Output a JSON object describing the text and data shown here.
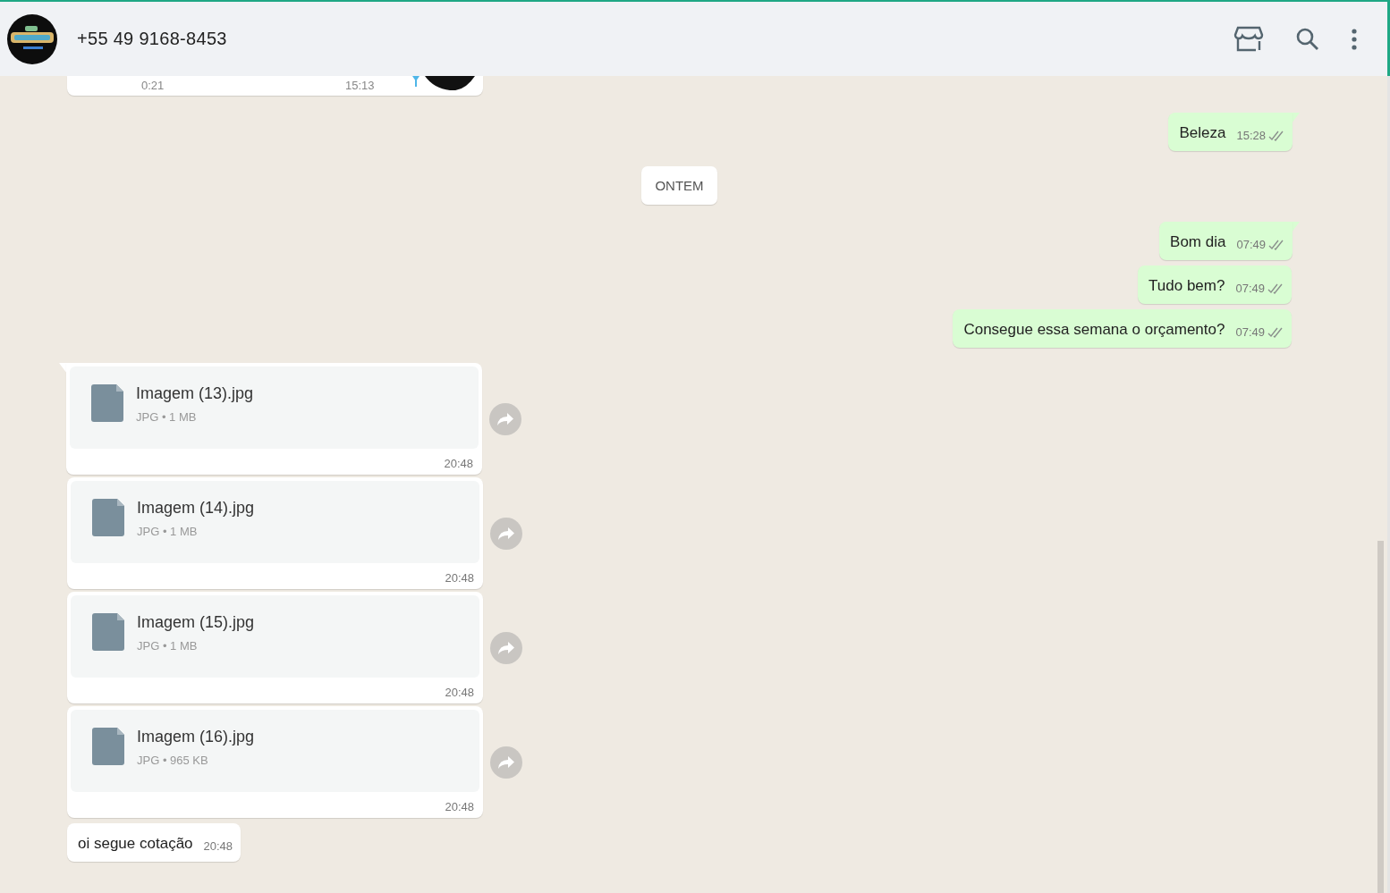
{
  "header": {
    "title": "+55 49 9168-8453"
  },
  "messages": [
    {
      "kind": "audio",
      "duration": "0:21",
      "time": "15:13"
    },
    {
      "kind": "text",
      "outgoing": true,
      "text": "Beleza",
      "time": "15:28",
      "read": false,
      "tail": true
    },
    {
      "kind": "date",
      "text": "ONTEM"
    },
    {
      "kind": "text",
      "outgoing": true,
      "text": "Bom dia",
      "time": "07:49",
      "read": false,
      "tail": true
    },
    {
      "kind": "text",
      "outgoing": true,
      "text": "Tudo bem?",
      "time": "07:49",
      "read": false,
      "tail": false
    },
    {
      "kind": "text",
      "outgoing": true,
      "text": "Consegue essa semana o orçamento?",
      "time": "07:49",
      "read": false,
      "tail": false
    },
    {
      "kind": "document",
      "name": "Imagem (13).jpg",
      "meta": "JPG • 1 MB",
      "time": "20:48",
      "tail": true
    },
    {
      "kind": "document",
      "name": "Imagem (14).jpg",
      "meta": "JPG • 1 MB",
      "time": "20:48",
      "tail": false
    },
    {
      "kind": "document",
      "name": "Imagem (15).jpg",
      "meta": "JPG • 1 MB",
      "time": "20:48",
      "tail": false
    },
    {
      "kind": "document",
      "name": "Imagem (16).jpg",
      "meta": "JPG • 965 KB",
      "time": "20:48",
      "tail": false
    },
    {
      "kind": "text",
      "outgoing": false,
      "text": "oi segue cotação",
      "time": "20:48",
      "tail": false
    }
  ]
}
